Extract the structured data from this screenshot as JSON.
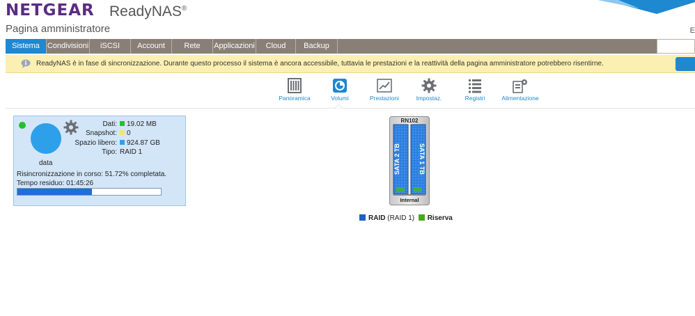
{
  "header": {
    "brand": "NETGEAR",
    "product": "ReadyNAS",
    "product_mark": "®",
    "admin_title": "Pagina amministratore",
    "right_char": "E"
  },
  "nav": {
    "tabs": [
      {
        "label": "Sistema",
        "active": true
      },
      {
        "label": "Condivisioni",
        "active": false
      },
      {
        "label": "iSCSI",
        "active": false
      },
      {
        "label": "Account",
        "active": false
      },
      {
        "label": "Rete",
        "active": false
      },
      {
        "label": "Applicazioni",
        "active": false
      },
      {
        "label": "Cloud",
        "active": false
      },
      {
        "label": "Backup",
        "active": false
      }
    ]
  },
  "notice": {
    "icon": "speech-bubble-info-icon",
    "text": "ReadyNAS è in fase di sincronizzazione. Durante questo processo il sistema è ancora accessibile, tuttavia le prestazioni e la reattività della pagina amministratore potrebbero risentirne."
  },
  "subnav": {
    "items": [
      {
        "label": "Panoramica",
        "icon": "overview-icon",
        "active": false
      },
      {
        "label": "Volumi",
        "icon": "volume-icon",
        "active": true
      },
      {
        "label": "Prestazioni",
        "icon": "performance-chart-icon",
        "active": false
      },
      {
        "label": "Impostaz.",
        "icon": "gear-icon",
        "active": false
      },
      {
        "label": "Registri",
        "icon": "list-icon",
        "active": false
      },
      {
        "label": "Alimentazione",
        "icon": "power-settings-icon",
        "active": false
      }
    ]
  },
  "volume": {
    "name": "data",
    "stats": {
      "data_label": "Dati:",
      "data_value": "19.02 MB",
      "snapshot_label": "Snapshot:",
      "snapshot_value": "0",
      "free_label": "Spazio libero:",
      "free_value": "924.87 GB",
      "type_label": "Tipo:",
      "type_value": "RAID 1"
    },
    "resync_text": "Risincronizzazione in corso: 51.72% completata.",
    "remaining_text": "Tempo residuo: 01:45:26",
    "progress_percent": 51.72
  },
  "device": {
    "model": "RN102",
    "disk1": "SATA 1 TB",
    "disk2": "SATA 2 TB",
    "location": "Internal"
  },
  "legend": {
    "raid_label": "RAID",
    "raid_type": "(RAID 1)",
    "spare_label": "Riserva"
  },
  "colors": {
    "accent": "#1e88d0",
    "brand": "#5a2c82",
    "data": "#22c22a",
    "snapshot": "#f5e27a",
    "free": "#2ea0ea",
    "raid": "#1f5fc4",
    "spare": "#4aa81f"
  }
}
